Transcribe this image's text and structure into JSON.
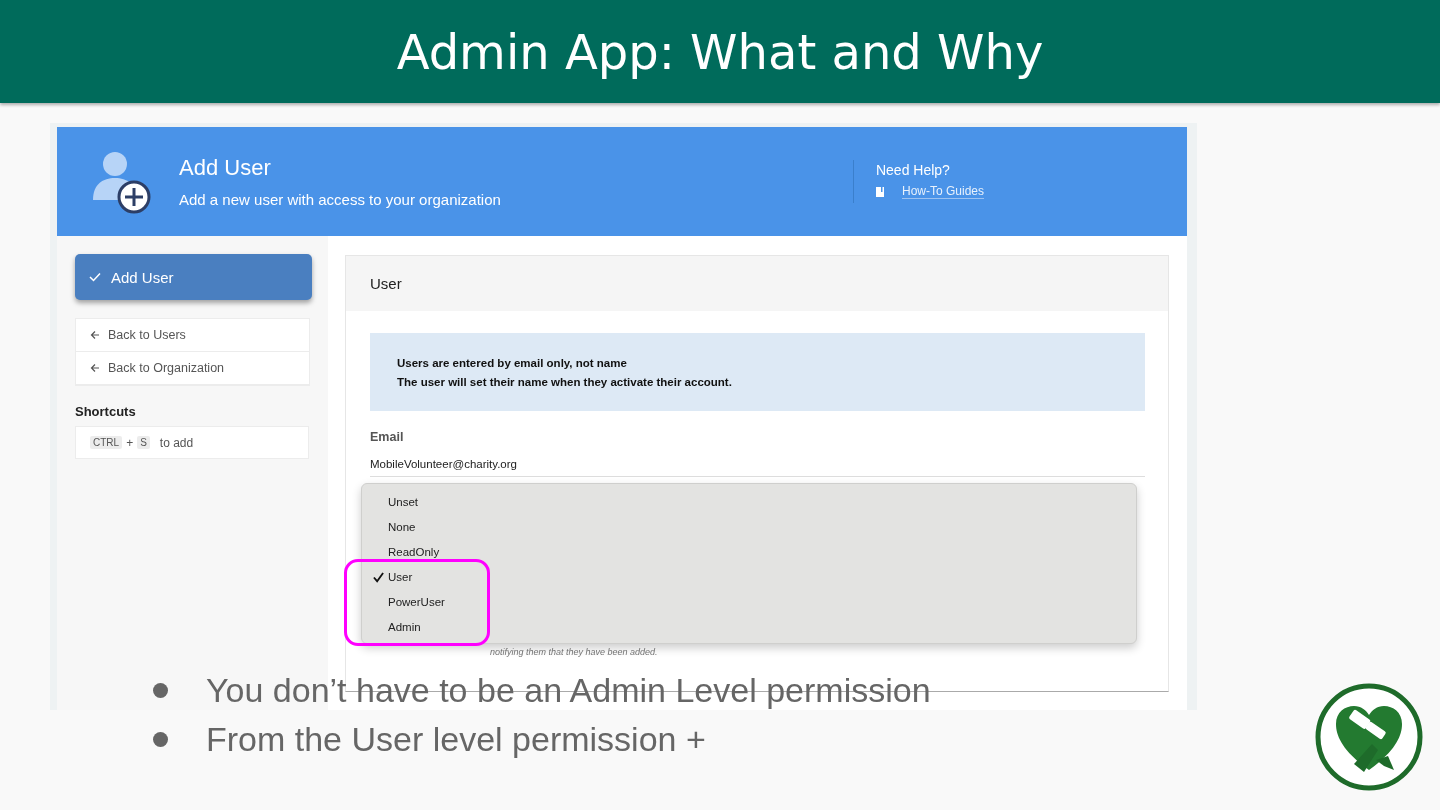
{
  "slide": {
    "title": "Admin App:  What and Why"
  },
  "app_header": {
    "title": "Add User",
    "subtitle": "Add a new user with access to your organization",
    "help_title": "Need Help?",
    "help_link": "How-To Guides"
  },
  "sidebar": {
    "primary_button": "Add User",
    "links": [
      "Back to Users",
      "Back to Organization"
    ],
    "shortcuts_title": "Shortcuts",
    "shortcut": {
      "keys": [
        "CTRL",
        "S"
      ],
      "joiner": "+",
      "text": "to add"
    }
  },
  "card": {
    "title": "User",
    "info_lines": [
      "Users are entered by email only, not name",
      "The user will set their name when they activate their account."
    ],
    "email_label": "Email",
    "email_value": "MobileVolunteer@charity.org",
    "note": "notifying them that they have been added.",
    "menu": [
      {
        "label": "Unset",
        "selected": false
      },
      {
        "label": "None",
        "selected": false
      },
      {
        "label": "ReadOnly",
        "selected": false
      },
      {
        "label": "User",
        "selected": true
      },
      {
        "label": "PowerUser",
        "selected": false
      },
      {
        "label": "Admin",
        "selected": false
      }
    ]
  },
  "bullets": [
    "You don’t have to be an Admin Level permission",
    "From the User level permission +"
  ]
}
